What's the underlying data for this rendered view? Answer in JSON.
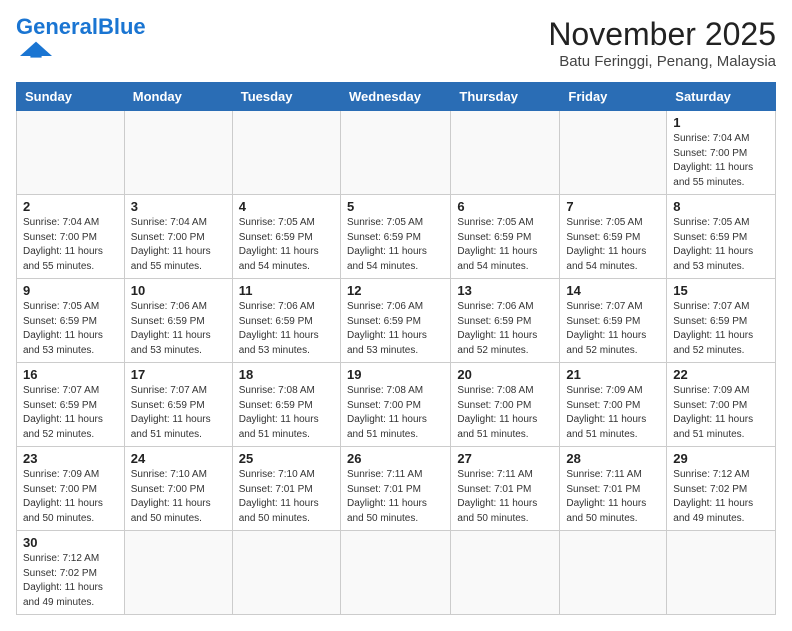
{
  "header": {
    "logo_general": "General",
    "logo_blue": "Blue",
    "month": "November 2025",
    "location": "Batu Feringgi, Penang, Malaysia"
  },
  "days_of_week": [
    "Sunday",
    "Monday",
    "Tuesday",
    "Wednesday",
    "Thursday",
    "Friday",
    "Saturday"
  ],
  "weeks": [
    [
      null,
      null,
      null,
      null,
      null,
      null,
      {
        "day": "1",
        "sunrise": "Sunrise: 7:04 AM",
        "sunset": "Sunset: 7:00 PM",
        "daylight": "Daylight: 11 hours and 55 minutes."
      }
    ],
    [
      {
        "day": "2",
        "sunrise": "Sunrise: 7:04 AM",
        "sunset": "Sunset: 7:00 PM",
        "daylight": "Daylight: 11 hours and 55 minutes."
      },
      {
        "day": "3",
        "sunrise": "Sunrise: 7:04 AM",
        "sunset": "Sunset: 7:00 PM",
        "daylight": "Daylight: 11 hours and 55 minutes."
      },
      {
        "day": "4",
        "sunrise": "Sunrise: 7:05 AM",
        "sunset": "Sunset: 6:59 PM",
        "daylight": "Daylight: 11 hours and 54 minutes."
      },
      {
        "day": "5",
        "sunrise": "Sunrise: 7:05 AM",
        "sunset": "Sunset: 6:59 PM",
        "daylight": "Daylight: 11 hours and 54 minutes."
      },
      {
        "day": "6",
        "sunrise": "Sunrise: 7:05 AM",
        "sunset": "Sunset: 6:59 PM",
        "daylight": "Daylight: 11 hours and 54 minutes."
      },
      {
        "day": "7",
        "sunrise": "Sunrise: 7:05 AM",
        "sunset": "Sunset: 6:59 PM",
        "daylight": "Daylight: 11 hours and 54 minutes."
      },
      {
        "day": "8",
        "sunrise": "Sunrise: 7:05 AM",
        "sunset": "Sunset: 6:59 PM",
        "daylight": "Daylight: 11 hours and 53 minutes."
      }
    ],
    [
      {
        "day": "9",
        "sunrise": "Sunrise: 7:05 AM",
        "sunset": "Sunset: 6:59 PM",
        "daylight": "Daylight: 11 hours and 53 minutes."
      },
      {
        "day": "10",
        "sunrise": "Sunrise: 7:06 AM",
        "sunset": "Sunset: 6:59 PM",
        "daylight": "Daylight: 11 hours and 53 minutes."
      },
      {
        "day": "11",
        "sunrise": "Sunrise: 7:06 AM",
        "sunset": "Sunset: 6:59 PM",
        "daylight": "Daylight: 11 hours and 53 minutes."
      },
      {
        "day": "12",
        "sunrise": "Sunrise: 7:06 AM",
        "sunset": "Sunset: 6:59 PM",
        "daylight": "Daylight: 11 hours and 53 minutes."
      },
      {
        "day": "13",
        "sunrise": "Sunrise: 7:06 AM",
        "sunset": "Sunset: 6:59 PM",
        "daylight": "Daylight: 11 hours and 52 minutes."
      },
      {
        "day": "14",
        "sunrise": "Sunrise: 7:07 AM",
        "sunset": "Sunset: 6:59 PM",
        "daylight": "Daylight: 11 hours and 52 minutes."
      },
      {
        "day": "15",
        "sunrise": "Sunrise: 7:07 AM",
        "sunset": "Sunset: 6:59 PM",
        "daylight": "Daylight: 11 hours and 52 minutes."
      }
    ],
    [
      {
        "day": "16",
        "sunrise": "Sunrise: 7:07 AM",
        "sunset": "Sunset: 6:59 PM",
        "daylight": "Daylight: 11 hours and 52 minutes."
      },
      {
        "day": "17",
        "sunrise": "Sunrise: 7:07 AM",
        "sunset": "Sunset: 6:59 PM",
        "daylight": "Daylight: 11 hours and 51 minutes."
      },
      {
        "day": "18",
        "sunrise": "Sunrise: 7:08 AM",
        "sunset": "Sunset: 6:59 PM",
        "daylight": "Daylight: 11 hours and 51 minutes."
      },
      {
        "day": "19",
        "sunrise": "Sunrise: 7:08 AM",
        "sunset": "Sunset: 7:00 PM",
        "daylight": "Daylight: 11 hours and 51 minutes."
      },
      {
        "day": "20",
        "sunrise": "Sunrise: 7:08 AM",
        "sunset": "Sunset: 7:00 PM",
        "daylight": "Daylight: 11 hours and 51 minutes."
      },
      {
        "day": "21",
        "sunrise": "Sunrise: 7:09 AM",
        "sunset": "Sunset: 7:00 PM",
        "daylight": "Daylight: 11 hours and 51 minutes."
      },
      {
        "day": "22",
        "sunrise": "Sunrise: 7:09 AM",
        "sunset": "Sunset: 7:00 PM",
        "daylight": "Daylight: 11 hours and 51 minutes."
      }
    ],
    [
      {
        "day": "23",
        "sunrise": "Sunrise: 7:09 AM",
        "sunset": "Sunset: 7:00 PM",
        "daylight": "Daylight: 11 hours and 50 minutes."
      },
      {
        "day": "24",
        "sunrise": "Sunrise: 7:10 AM",
        "sunset": "Sunset: 7:00 PM",
        "daylight": "Daylight: 11 hours and 50 minutes."
      },
      {
        "day": "25",
        "sunrise": "Sunrise: 7:10 AM",
        "sunset": "Sunset: 7:01 PM",
        "daylight": "Daylight: 11 hours and 50 minutes."
      },
      {
        "day": "26",
        "sunrise": "Sunrise: 7:11 AM",
        "sunset": "Sunset: 7:01 PM",
        "daylight": "Daylight: 11 hours and 50 minutes."
      },
      {
        "day": "27",
        "sunrise": "Sunrise: 7:11 AM",
        "sunset": "Sunset: 7:01 PM",
        "daylight": "Daylight: 11 hours and 50 minutes."
      },
      {
        "day": "28",
        "sunrise": "Sunrise: 7:11 AM",
        "sunset": "Sunset: 7:01 PM",
        "daylight": "Daylight: 11 hours and 50 minutes."
      },
      {
        "day": "29",
        "sunrise": "Sunrise: 7:12 AM",
        "sunset": "Sunset: 7:02 PM",
        "daylight": "Daylight: 11 hours and 49 minutes."
      }
    ],
    [
      {
        "day": "30",
        "sunrise": "Sunrise: 7:12 AM",
        "sunset": "Sunset: 7:02 PM",
        "daylight": "Daylight: 11 hours and 49 minutes."
      },
      null,
      null,
      null,
      null,
      null,
      null
    ]
  ]
}
